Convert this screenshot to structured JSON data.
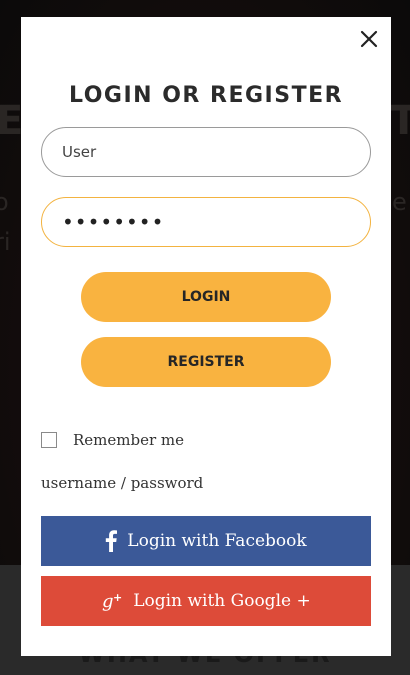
{
  "background": {
    "section_title": "WHAT WE OFFER"
  },
  "modal": {
    "title": "LOGIN OR REGISTER",
    "close_icon": "close-icon",
    "username_value": "User",
    "password_value": "••••••••",
    "login_label": "LOGIN",
    "register_label": "REGISTER",
    "remember_label": "Remember me",
    "remember_checked": false,
    "forgot_link": "username / password",
    "facebook_label": "Login with Facebook",
    "google_label": "Login with Google +"
  },
  "colors": {
    "accent": "#f9b340",
    "facebook": "#3b5998",
    "google": "#dd4b39"
  }
}
